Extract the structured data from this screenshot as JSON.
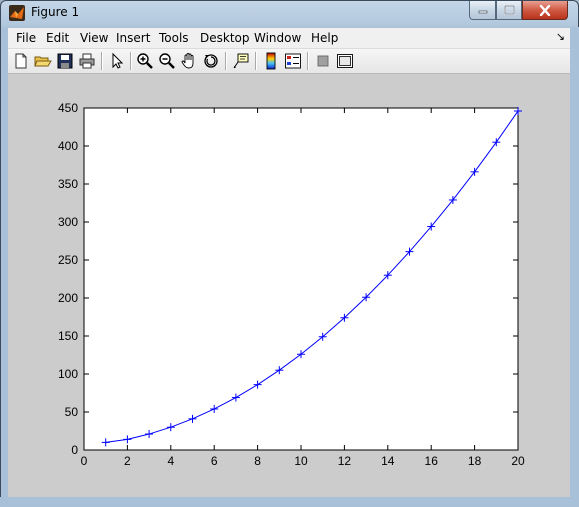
{
  "window": {
    "title": "Figure 1"
  },
  "menu": {
    "items": [
      "File",
      "Edit",
      "View",
      "Insert",
      "Tools",
      "Desktop",
      "Window",
      "Help"
    ],
    "overflow_glyph": "↘"
  },
  "toolbar": {
    "buttons": [
      "new-figure-icon",
      "open-file-icon",
      "save-icon",
      "print-icon",
      "edit-plot-arrow-icon",
      "zoom-in-icon",
      "zoom-out-icon",
      "pan-hand-icon",
      "rotate-3d-icon",
      "data-cursor-icon",
      "insert-colorbar-icon",
      "insert-legend-icon",
      "hide-plot-tools-icon",
      "show-plot-tools-icon"
    ]
  },
  "colors": {
    "series": "#0000ff",
    "figure_background": "#cccccc",
    "axes_background": "#ffffff",
    "close_button": "#c8462f"
  },
  "chart_data": {
    "type": "line",
    "marker": "+",
    "x": [
      1,
      2,
      3,
      4,
      5,
      6,
      7,
      8,
      9,
      10,
      11,
      12,
      13,
      14,
      15,
      16,
      17,
      18,
      19,
      20
    ],
    "series": [
      {
        "values": [
          10,
          14,
          21,
          30,
          41,
          54,
          69,
          86,
          105,
          126,
          149,
          174,
          201,
          230,
          261,
          294,
          329,
          366,
          405,
          446
        ]
      }
    ],
    "xlim": [
      0,
      20
    ],
    "ylim": [
      0,
      450
    ],
    "xticks": [
      "0",
      "2",
      "4",
      "6",
      "8",
      "10",
      "12",
      "14",
      "16",
      "18",
      "20"
    ],
    "yticks": [
      "0",
      "50",
      "100",
      "150",
      "200",
      "250",
      "300",
      "350",
      "400",
      "450"
    ],
    "grid": false,
    "title": "",
    "xlabel": "",
    "ylabel": ""
  }
}
